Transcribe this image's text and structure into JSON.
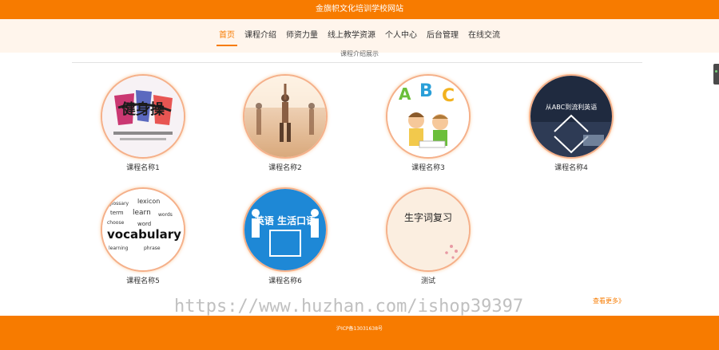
{
  "site": {
    "title": "金旗帜文化培训学校网站"
  },
  "nav": {
    "items": [
      {
        "label": "首页",
        "active": true
      },
      {
        "label": "课程介绍",
        "active": false
      },
      {
        "label": "师资力量",
        "active": false
      },
      {
        "label": "线上教学资源",
        "active": false
      },
      {
        "label": "个人中心",
        "active": false
      },
      {
        "label": "后台管理",
        "active": false
      },
      {
        "label": "在线交流",
        "active": false
      }
    ]
  },
  "section": {
    "title": "课程介绍展示"
  },
  "courses": [
    {
      "name": "课程名称1",
      "image": "calligraphy-jianshen-image",
      "caption": "健身操"
    },
    {
      "name": "课程名称2",
      "image": "yoga-class-image",
      "caption": ""
    },
    {
      "name": "课程名称3",
      "image": "abc-kids-image",
      "caption": "ABC"
    },
    {
      "name": "课程名称4",
      "image": "english-study-image",
      "caption": "从ABC到流利英语"
    },
    {
      "name": "课程名称5",
      "image": "vocabulary-wordcloud-image",
      "caption": "vocabulary word"
    },
    {
      "name": "课程名称6",
      "image": "english-oral-image",
      "caption": "英语 生活口语"
    },
    {
      "name": "测试",
      "image": "chinese-review-image",
      "caption": "生字词复习"
    }
  ],
  "more_link": "查看更多》",
  "watermark": "https://www.huzhan.com/ishop39397",
  "footer": {
    "icp": "沪ICP备13031638号"
  },
  "colors": {
    "accent": "#f77b00",
    "nav_band": "#fff5ec"
  }
}
